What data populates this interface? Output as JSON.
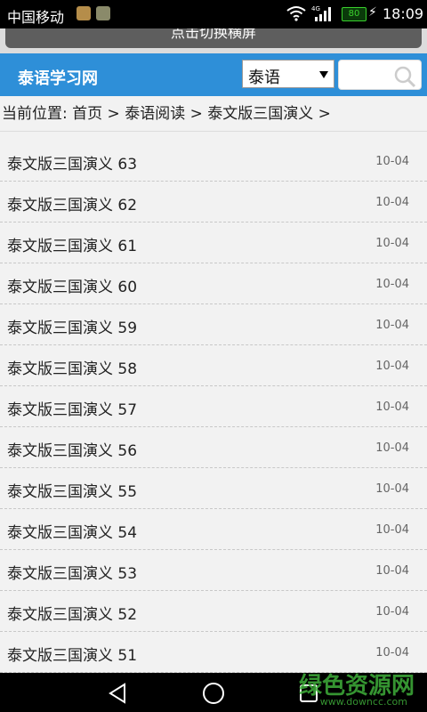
{
  "status_bar": {
    "carrier": "中国移动",
    "battery": "80",
    "time": "18:09",
    "network": "4G"
  },
  "switch_bar": {
    "label": "点击切换横屏"
  },
  "header": {
    "site_title": "泰语学习网",
    "language_select": "泰语",
    "search_placeholder": ""
  },
  "breadcrumb": {
    "label": "当前位置:",
    "items": [
      "首页",
      "泰语阅读",
      "泰文版三国演义"
    ],
    "separator": ">"
  },
  "articles": [
    {
      "title": "泰文版三国演义 63",
      "date": "10-04"
    },
    {
      "title": "泰文版三国演义 62",
      "date": "10-04"
    },
    {
      "title": "泰文版三国演义 61",
      "date": "10-04"
    },
    {
      "title": "泰文版三国演义 60",
      "date": "10-04"
    },
    {
      "title": "泰文版三国演义 59",
      "date": "10-04"
    },
    {
      "title": "泰文版三国演义 58",
      "date": "10-04"
    },
    {
      "title": "泰文版三国演义 57",
      "date": "10-04"
    },
    {
      "title": "泰文版三国演义 56",
      "date": "10-04"
    },
    {
      "title": "泰文版三国演义 55",
      "date": "10-04"
    },
    {
      "title": "泰文版三国演义 54",
      "date": "10-04"
    },
    {
      "title": "泰文版三国演义 53",
      "date": "10-04"
    },
    {
      "title": "泰文版三国演义 52",
      "date": "10-04"
    },
    {
      "title": "泰文版三国演义 51",
      "date": "10-04"
    }
  ],
  "watermark": {
    "text": "绿色资源网",
    "url": "www.downcc.com"
  },
  "colors": {
    "header": "#2e8fd8",
    "watermark": "#3fae3a"
  }
}
